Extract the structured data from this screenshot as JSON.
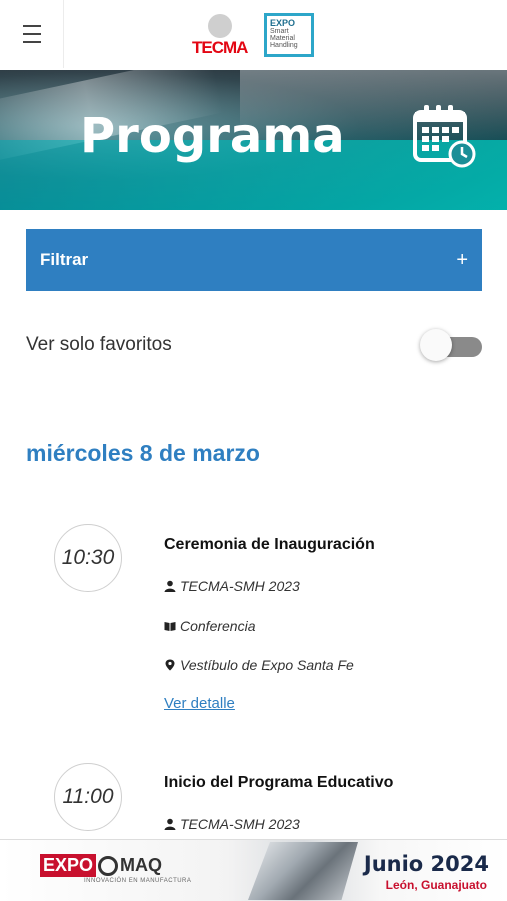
{
  "header": {
    "logo_tecma": "TECMA",
    "logo_expo": {
      "title": "EXPO",
      "subtitle_1": "Smart",
      "subtitle_2": "Material",
      "subtitle_3": "Handling"
    }
  },
  "banner": {
    "title": "Programa",
    "icon": "calendar-clock-icon"
  },
  "filter": {
    "label": "Filtrar",
    "icon": "plus-icon",
    "color": "#2f7fc1"
  },
  "favorites": {
    "label": "Ver solo favoritos",
    "enabled": false
  },
  "schedule": {
    "date_heading": "miércoles 8 de marzo",
    "events": [
      {
        "time": "10:30",
        "title": "Ceremonia de Inauguración",
        "organizer": "TECMA-SMH 2023",
        "type": "Conferencia",
        "location": "Vestíbulo de Expo Santa Fe",
        "link_label": "Ver detalle"
      },
      {
        "time": "11:00",
        "title": "Inicio del Programa Educativo",
        "organizer": "TECMA-SMH 2023"
      }
    ]
  },
  "ad": {
    "brand_left": "EXPO",
    "brand_right": "MAQ",
    "brand_sub": "INNOVACIÓN EN MANUFACTURA",
    "date": "Junio 2024",
    "place": "León, Guanajuato"
  }
}
